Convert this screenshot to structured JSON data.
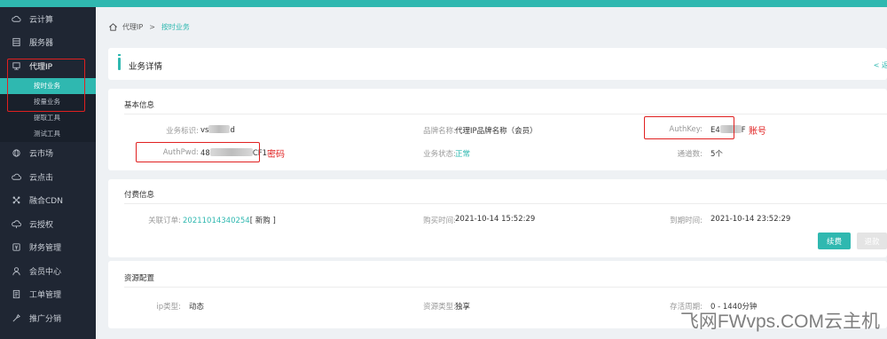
{
  "sidebar": {
    "items": [
      {
        "label": "云计算",
        "icon": "cloud-icon"
      },
      {
        "label": "服务器",
        "icon": "server-icon"
      },
      {
        "label": "代理IP",
        "icon": "monitor-icon"
      },
      {
        "label": "云市场",
        "icon": "globe-icon"
      },
      {
        "label": "云点击",
        "icon": "cloud-click-icon"
      },
      {
        "label": "融合CDN",
        "icon": "cdn-icon"
      },
      {
        "label": "云授权",
        "icon": "cloud-auth-icon"
      },
      {
        "label": "财务管理",
        "icon": "finance-icon"
      },
      {
        "label": "会员中心",
        "icon": "user-icon"
      },
      {
        "label": "工单管理",
        "icon": "ticket-icon"
      },
      {
        "label": "推广分销",
        "icon": "share-icon"
      }
    ],
    "subitems": [
      {
        "label": "按时业务",
        "active": true
      },
      {
        "label": "按量业务",
        "active": false
      },
      {
        "label": "提取工具",
        "active": false
      },
      {
        "label": "测试工具",
        "active": false
      }
    ]
  },
  "breadcrumb": {
    "root": "代理IP",
    "sep": ">",
    "current": "按时业务"
  },
  "page": {
    "title": "业务详情",
    "back": "< 返"
  },
  "basic": {
    "title": "基本信息",
    "biz_id_label": "业务标识:",
    "biz_id_prefix": "vs",
    "biz_id_suffix": "d",
    "brand_label": "品牌名称:",
    "brand_value": "代理IP品牌名称（会员）",
    "authkey_label": "AuthKey:",
    "authkey_prefix": "E4",
    "authkey_suffix": "F",
    "authpwd_label": "AuthPwd:",
    "authpwd_prefix": "48",
    "authpwd_suffix": "CF1",
    "status_label": "业务状态:",
    "status_value": "正常",
    "channels_label": "通道数:",
    "channels_value": "5个",
    "note_account": "账号",
    "note_password": "密码"
  },
  "billing": {
    "title": "付费信息",
    "order_label": "关联订单:",
    "order_id": "20211014340254",
    "order_tag": "[ 新购 ]",
    "buy_label": "购买时间:",
    "buy_value": "2021-10-14 15:52:29",
    "expire_label": "到期时间:",
    "expire_value": "2021-10-14 23:52:29",
    "renew_btn": "续费",
    "refund_btn": "退款"
  },
  "resource": {
    "title": "资源配置",
    "ip_type_label": "ip类型:",
    "ip_type_value": "动态",
    "res_type_label": "资源类型:",
    "res_type_value": "独享",
    "ttl_label": "存活周期:",
    "ttl_value": "0 - 1440分钟"
  },
  "watermark": "飞网FWvps.COM云主机",
  "colors": {
    "accent": "#2fb8b0",
    "sidebar": "#1f2633",
    "annotation": "#e02020"
  }
}
